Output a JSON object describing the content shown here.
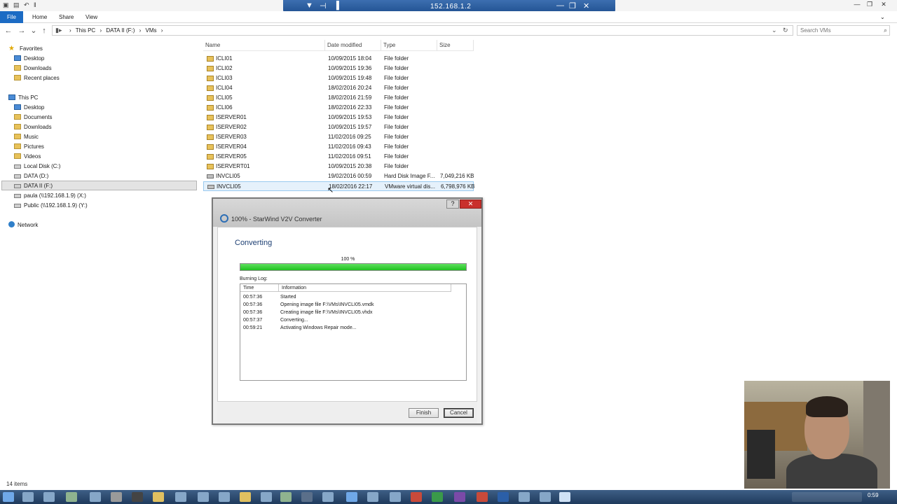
{
  "window": {
    "quick_access": "▣ ▤ ↶ ‖",
    "minimize": "—",
    "restore": "❐",
    "close": "✕"
  },
  "rdp": {
    "host": "152.168.1.2",
    "pin": "▼",
    "pin_icon": "⊣",
    "signal": "▐",
    "minimize": "—",
    "restore": "❐",
    "close": "✕"
  },
  "ribbon": {
    "tabs": [
      "File",
      "Home",
      "Share",
      "View"
    ]
  },
  "address": {
    "path": [
      "This PC",
      "›",
      "DATA II (F:)",
      "›",
      "VMs",
      "›"
    ],
    "dropdown": "⌄",
    "refresh": "↻"
  },
  "nav_buttons": {
    "back": "←",
    "forward": "→",
    "recent": "⌄",
    "up": "↑"
  },
  "search": {
    "placeholder": "Search VMs",
    "icon": "search-icon"
  },
  "navpane": {
    "favorites": {
      "label": "Favorites",
      "items": [
        "Desktop",
        "Downloads",
        "Recent places"
      ]
    },
    "this_pc": {
      "label": "This PC",
      "items": [
        "Desktop",
        "Documents",
        "Downloads",
        "Music",
        "Pictures",
        "Videos",
        "Local Disk (C:)",
        "DATA (D:)",
        "DATA II (F:)",
        "paula (\\\\192.168.1.9) (X:)",
        "Public (\\\\192.168.1.9) (Y:)"
      ]
    },
    "network": {
      "label": "Network"
    }
  },
  "filelist": {
    "columns": [
      "Name",
      "Date modified",
      "Type",
      "Size"
    ],
    "rows": [
      {
        "name": "ICLI01",
        "date": "10/09/2015 18:04",
        "type": "File folder",
        "size": "",
        "kind": "folder"
      },
      {
        "name": "ICLI02",
        "date": "10/09/2015 19:36",
        "type": "File folder",
        "size": "",
        "kind": "folder"
      },
      {
        "name": "ICLI03",
        "date": "10/09/2015 19:48",
        "type": "File folder",
        "size": "",
        "kind": "folder"
      },
      {
        "name": "ICLI04",
        "date": "18/02/2016 20:24",
        "type": "File folder",
        "size": "",
        "kind": "folder"
      },
      {
        "name": "ICLI05",
        "date": "18/02/2016 21:59",
        "type": "File folder",
        "size": "",
        "kind": "folder"
      },
      {
        "name": "ICLI06",
        "date": "18/02/2016 22:33",
        "type": "File folder",
        "size": "",
        "kind": "folder"
      },
      {
        "name": "ISERVER01",
        "date": "10/09/2015 19:53",
        "type": "File folder",
        "size": "",
        "kind": "folder"
      },
      {
        "name": "ISERVER02",
        "date": "10/09/2015 19:57",
        "type": "File folder",
        "size": "",
        "kind": "folder"
      },
      {
        "name": "ISERVER03",
        "date": "11/02/2016 09:25",
        "type": "File folder",
        "size": "",
        "kind": "folder"
      },
      {
        "name": "ISERVER04",
        "date": "11/02/2016 09:43",
        "type": "File folder",
        "size": "",
        "kind": "folder"
      },
      {
        "name": "ISERVER05",
        "date": "11/02/2016 09:51",
        "type": "File folder",
        "size": "",
        "kind": "folder"
      },
      {
        "name": "ISERVERT01",
        "date": "10/09/2015 20:38",
        "type": "File folder",
        "size": "",
        "kind": "folder"
      },
      {
        "name": "INVCLI05",
        "date": "19/02/2016 00:59",
        "type": "Hard Disk Image F...",
        "size": "7,049,216 KB",
        "kind": "disk"
      },
      {
        "name": "INVCLI05",
        "date": "18/02/2016 22:17",
        "type": "VMware virtual dis...",
        "size": "6,798,976 KB",
        "kind": "disk"
      }
    ]
  },
  "dialog": {
    "title": "100% - StarWind V2V Converter",
    "help": "?",
    "close": "✕",
    "heading": "Converting",
    "progress_label": "100 %",
    "progress": 1.0,
    "log_label": "Burning Log:",
    "log_columns": [
      "Time",
      "Information"
    ],
    "log_rows": [
      {
        "time": "00:57:36",
        "info": "Started"
      },
      {
        "time": "00:57:36",
        "info": "Opening image file F:\\VMs\\INVCLI05.vmdk"
      },
      {
        "time": "00:57:36",
        "info": "Creating image file F:\\VMs\\INVCLI05.vhdx"
      },
      {
        "time": "00:57:37",
        "info": "Converting..."
      },
      {
        "time": "00:59:21",
        "info": "Activating Windows Repair mode..."
      }
    ],
    "finish_label": "Finish",
    "cancel_label": "Cancel"
  },
  "status": {
    "items_count": "14 items"
  },
  "taskbar": {
    "clock": "0:59"
  },
  "colors": {
    "accent": "#1c6bc4",
    "progress": "#1fc21f",
    "close": "#c9302c",
    "taskbar": "#1f3a5c"
  }
}
